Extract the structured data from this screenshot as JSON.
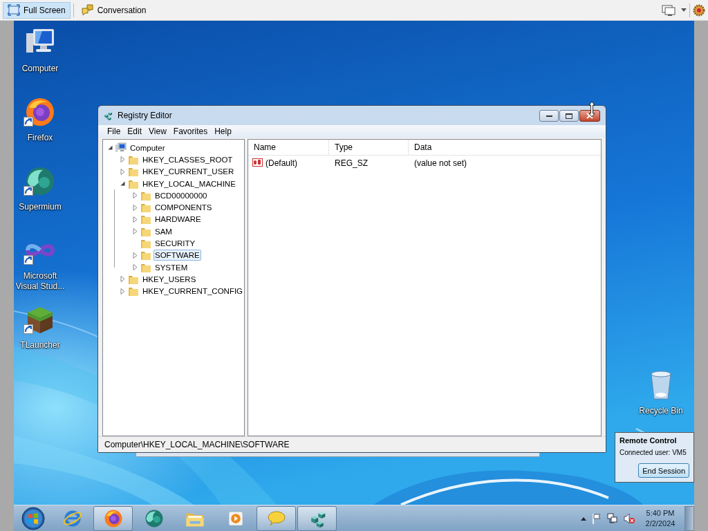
{
  "viewer_toolbar": {
    "buttons": [
      {
        "label": "Full Screen",
        "kind": "fullscreen",
        "selected": true
      },
      {
        "label": "Conversation",
        "kind": "conversation",
        "selected": false
      }
    ]
  },
  "desktop_icons": [
    {
      "label": "Computer",
      "kind": "computer",
      "shortcut": false
    },
    {
      "label": "Firefox",
      "kind": "firefox",
      "shortcut": true
    },
    {
      "label": "Supermium",
      "kind": "supermium",
      "shortcut": true
    },
    {
      "label": "Microsoft Visual Stud...",
      "kind": "visualstudio",
      "shortcut": true
    },
    {
      "label": "TLauncher",
      "kind": "tlauncher",
      "shortcut": true
    }
  ],
  "recycle_bin": {
    "label": "Recycle Bin"
  },
  "window": {
    "title": "Registry Editor",
    "menu": [
      "File",
      "Edit",
      "View",
      "Favorites",
      "Help"
    ],
    "tree": {
      "label": "Computer",
      "expandable": true,
      "expanded": true,
      "selected": false,
      "children": [
        {
          "label": "HKEY_CLASSES_ROOT",
          "expandable": true,
          "expanded": false,
          "selected": false
        },
        {
          "label": "HKEY_CURRENT_USER",
          "expandable": true,
          "expanded": false,
          "selected": false
        },
        {
          "label": "HKEY_LOCAL_MACHINE",
          "expandable": true,
          "expanded": true,
          "selected": false,
          "children": [
            {
              "label": "BCD00000000",
              "expandable": true,
              "expanded": false,
              "selected": false
            },
            {
              "label": "COMPONENTS",
              "expandable": true,
              "expanded": false,
              "selected": false
            },
            {
              "label": "HARDWARE",
              "expandable": true,
              "expanded": false,
              "selected": false
            },
            {
              "label": "SAM",
              "expandable": true,
              "expanded": false,
              "selected": false
            },
            {
              "label": "SECURITY",
              "expandable": false,
              "selected": false
            },
            {
              "label": "SOFTWARE",
              "expandable": true,
              "expanded": false,
              "selected": true
            },
            {
              "label": "SYSTEM",
              "expandable": true,
              "expanded": false,
              "selected": false
            }
          ]
        },
        {
          "label": "HKEY_USERS",
          "expandable": true,
          "expanded": false,
          "selected": false
        },
        {
          "label": "HKEY_CURRENT_CONFIG",
          "expandable": true,
          "expanded": false,
          "selected": false
        }
      ]
    },
    "columns": [
      "Name",
      "Type",
      "Data"
    ],
    "rows": [
      {
        "name": "(Default)",
        "type": "REG_SZ",
        "data": "(value not set)"
      }
    ],
    "status_bar": "Computer\\HKEY_LOCAL_MACHINE\\SOFTWARE"
  },
  "remote_control": {
    "title": "Remote Control",
    "text": "Connected user: VM5",
    "button": "End Session"
  },
  "taskbar": {
    "items": [
      {
        "kind": "ie",
        "running": false
      },
      {
        "kind": "firefox",
        "running": true
      },
      {
        "kind": "supermium",
        "running": false
      },
      {
        "kind": "explorer",
        "running": false
      },
      {
        "kind": "mediaplayer",
        "running": false
      },
      {
        "kind": "chat",
        "running": true
      },
      {
        "kind": "regedit",
        "running": true
      }
    ],
    "clock": {
      "time": "5:40 PM",
      "date": "2/2/2024"
    }
  }
}
